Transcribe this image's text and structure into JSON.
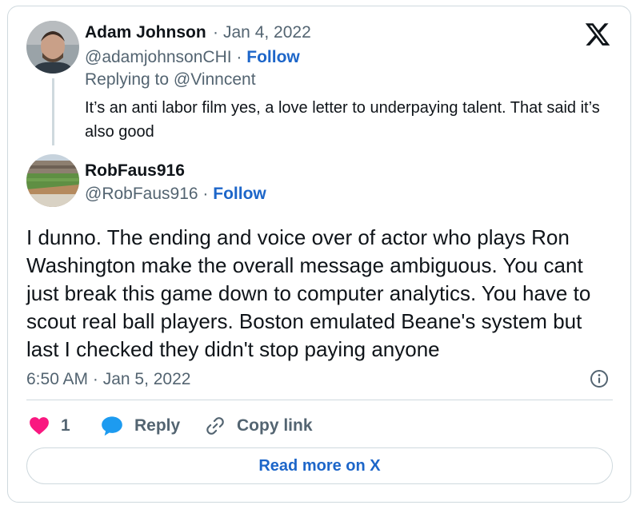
{
  "reply_tweet": {
    "author_name": "Adam Johnson",
    "date": "Jan 4, 2022",
    "handle": "@adamjohnsonCHI",
    "follow_label": "Follow",
    "replying_to": "Replying to @Vinncent",
    "text": "It’s an anti labor film yes, a love letter to underpaying talent. That said it’s also good"
  },
  "main_tweet": {
    "author_name": "RobFaus916",
    "handle": "@RobFaus916",
    "follow_label": "Follow",
    "text": "I dunno. The ending and voice over of actor who plays Ron Washington make the overall message ambiguous. You cant just break this game down to computer analytics. You have to scout real ball players. Boston emulated Beane's system but last I checked they didn't stop paying anyone",
    "timestamp": "6:50 AM · Jan 5, 2022"
  },
  "actions": {
    "like_count": "1",
    "reply_label": "Reply",
    "copy_label": "Copy link"
  },
  "read_more_label": "Read more on X",
  "icons": {
    "brand": "x-logo-icon",
    "like": "heart-icon",
    "reply": "speech-bubble-icon",
    "copy": "link-icon",
    "info": "info-icon"
  },
  "colors": {
    "accent": "#1d66c9",
    "like": "#f91880",
    "reply": "#1d9bf0",
    "muted": "#536471",
    "border": "#cfd9de"
  }
}
